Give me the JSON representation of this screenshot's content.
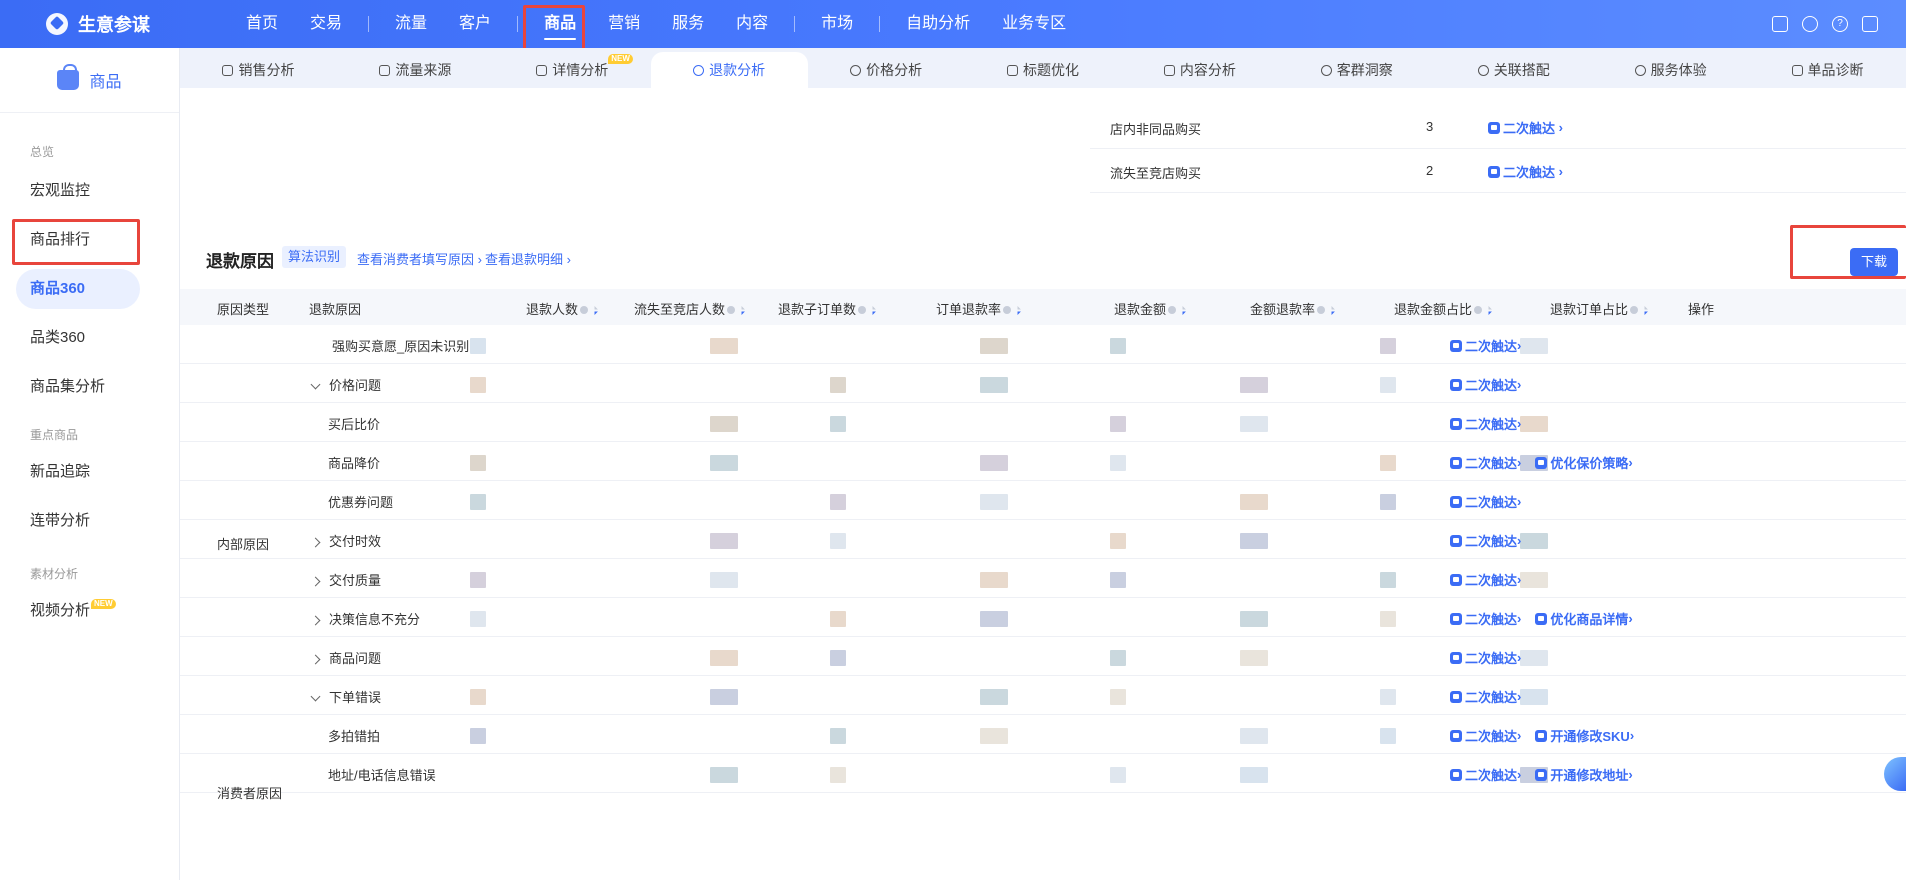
{
  "app": {
    "name": "生意参谋"
  },
  "nav": [
    {
      "label": "首页",
      "active": false
    },
    {
      "label": "交易",
      "active": false
    },
    {
      "label": "流量",
      "active": false
    },
    {
      "label": "客户",
      "active": false
    },
    {
      "label": "商品",
      "active": true
    },
    {
      "label": "营销",
      "active": false
    },
    {
      "label": "服务",
      "active": false
    },
    {
      "label": "内容",
      "active": false
    },
    {
      "label": "市场",
      "active": false
    },
    {
      "label": "自助分析",
      "active": false
    },
    {
      "label": "业务专区",
      "active": false
    }
  ],
  "top_icons": [
    "message-icon",
    "user-icon",
    "help-icon",
    "logout-icon"
  ],
  "sidebar": {
    "title": "商品",
    "groups": {
      "overview": "总览",
      "key_products": "重点商品",
      "material": "素材分析"
    },
    "items": [
      {
        "label": "宏观监控"
      },
      {
        "label": "商品排行"
      },
      {
        "label": "商品360",
        "active": true
      },
      {
        "label": "品类360"
      },
      {
        "label": "商品集分析"
      },
      {
        "label": "新品追踪"
      },
      {
        "label": "连带分析"
      },
      {
        "label": "视频分析",
        "badge": "NEW"
      }
    ]
  },
  "subtabs": [
    {
      "label": "销售分析",
      "icon": "bag-icon"
    },
    {
      "label": "流量来源",
      "icon": "traffic-icon"
    },
    {
      "label": "详情分析",
      "icon": "detail-icon",
      "badge": "NEW"
    },
    {
      "label": "退款分析",
      "icon": "refund-icon",
      "active": true
    },
    {
      "label": "价格分析",
      "icon": "price-icon"
    },
    {
      "label": "标题优化",
      "icon": "title-icon"
    },
    {
      "label": "内容分析",
      "icon": "content-icon"
    },
    {
      "label": "客群洞察",
      "icon": "crowd-icon"
    },
    {
      "label": "关联搭配",
      "icon": "link-icon"
    },
    {
      "label": "服务体验",
      "icon": "service-icon"
    },
    {
      "label": "单品诊断",
      "icon": "diagnose-icon"
    }
  ],
  "upper_table": [
    {
      "label": "店内非同品购买",
      "value": "3",
      "action": "二次触达"
    },
    {
      "label": "流失至竞店购买",
      "value": "2",
      "action": "二次触达"
    }
  ],
  "section": {
    "title": "退款原因",
    "tag": "算法识别",
    "link1": "查看消费者填写原因",
    "link2": "查看退款明细",
    "download": "下载"
  },
  "table": {
    "headers": [
      "原因类型",
      "退款原因",
      "退款人数",
      "流失至竞店人数",
      "退款子订单数",
      "订单退款率",
      "退款金额",
      "金额退款率",
      "退款金额占比",
      "退款订单占比",
      "操作"
    ],
    "group_internal": "内部原因",
    "group_consumer": "消费者原因",
    "rows": [
      {
        "reason": "强购买意愿_原因未识别",
        "level": 0,
        "expand": "none",
        "actions": [
          "二次触达"
        ]
      },
      {
        "reason": "价格问题",
        "level": 0,
        "expand": "down",
        "actions": [
          "二次触达"
        ]
      },
      {
        "reason": "买后比价",
        "level": 1,
        "expand": "none",
        "actions": [
          "二次触达"
        ]
      },
      {
        "reason": "商品降价",
        "level": 1,
        "expand": "none",
        "actions": [
          "二次触达",
          "优化保价策略"
        ]
      },
      {
        "reason": "优惠券问题",
        "level": 1,
        "expand": "none",
        "actions": [
          "二次触达"
        ]
      },
      {
        "reason": "交付时效",
        "level": 0,
        "expand": "right",
        "actions": [
          "二次触达"
        ]
      },
      {
        "reason": "交付质量",
        "level": 0,
        "expand": "right",
        "actions": [
          "二次触达"
        ]
      },
      {
        "reason": "决策信息不充分",
        "level": 0,
        "expand": "right",
        "actions": [
          "二次触达",
          "优化商品详情"
        ]
      },
      {
        "reason": "商品问题",
        "level": 0,
        "expand": "right",
        "actions": [
          "二次触达"
        ]
      },
      {
        "reason": "下单错误",
        "level": 0,
        "expand": "down",
        "actions": [
          "二次触达"
        ]
      },
      {
        "reason": "多拍错拍",
        "level": 1,
        "expand": "none",
        "actions": [
          "二次触达",
          "开通修改SKU"
        ]
      },
      {
        "reason": "地址/电话信息错误",
        "level": 1,
        "expand": "none",
        "actions": [
          "二次触达",
          "开通修改地址"
        ]
      }
    ]
  },
  "colors": {
    "brand": "#3b6cf5",
    "highlight": "#e8453c"
  }
}
